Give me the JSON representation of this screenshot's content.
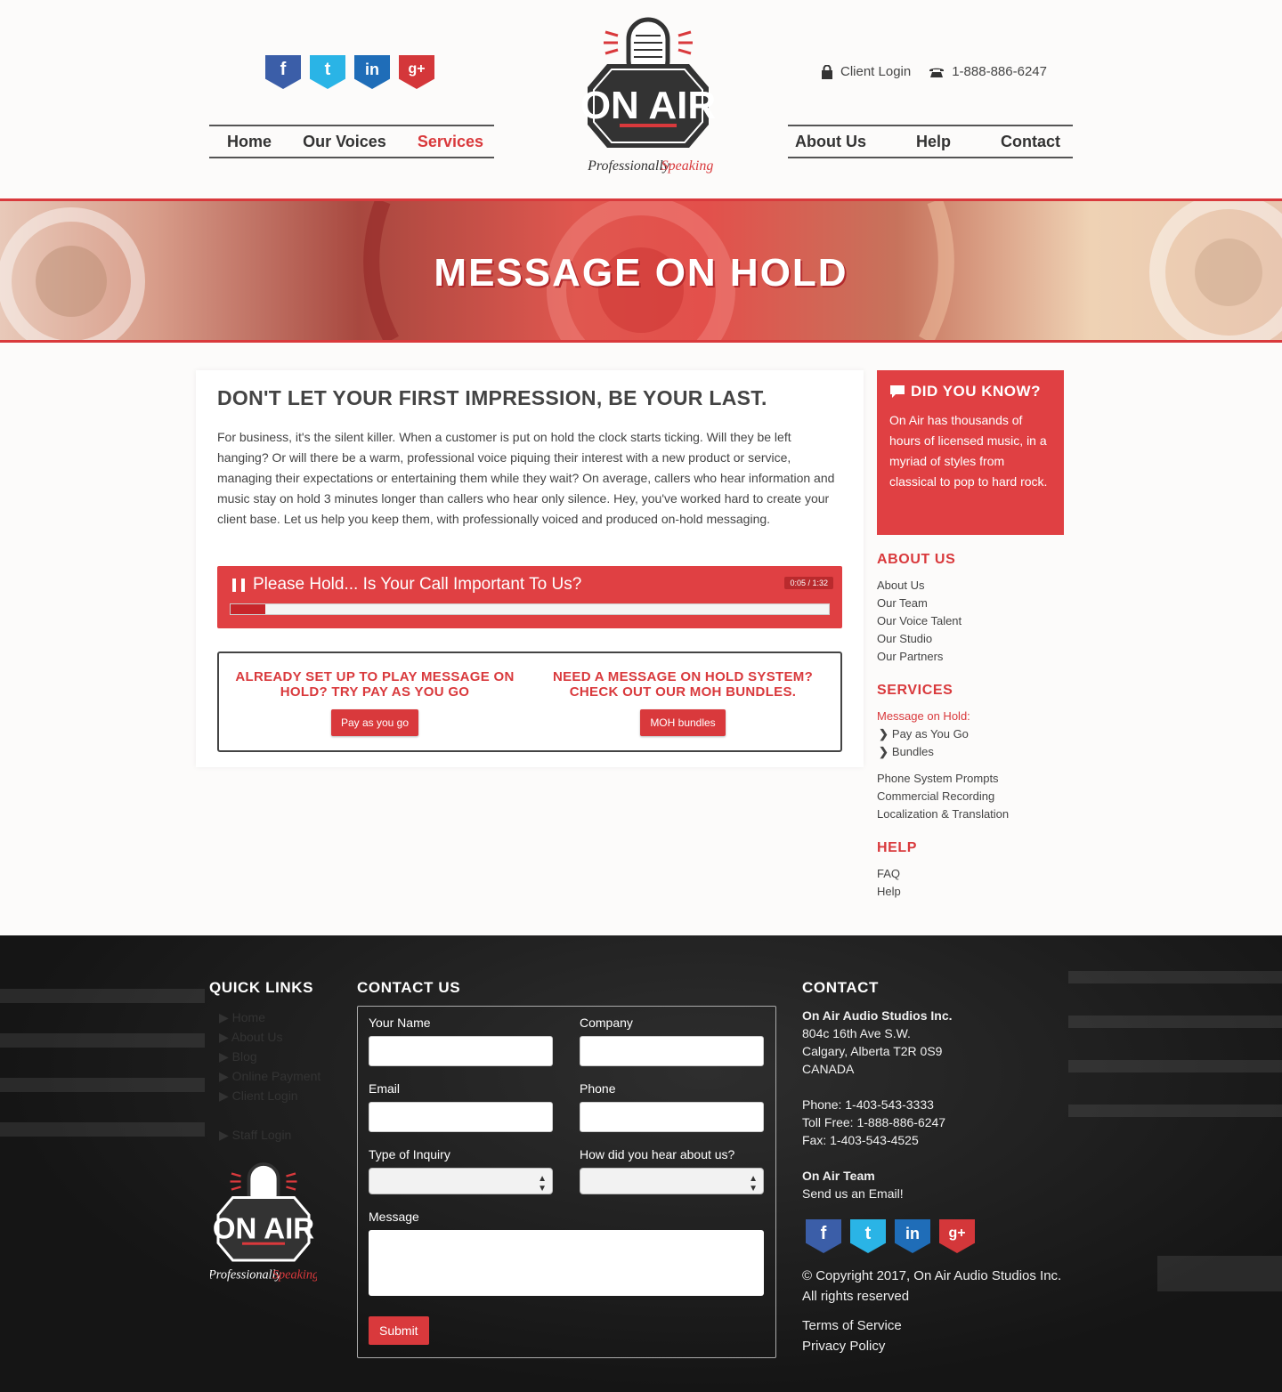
{
  "header": {
    "social": [
      {
        "label": "f",
        "icon": "facebook-icon",
        "color": "#3b5ea8"
      },
      {
        "label": "t",
        "icon": "twitter-icon",
        "color": "#2ab4e6"
      },
      {
        "label": "in",
        "icon": "linkedin-icon",
        "color": "#1f6db8"
      },
      {
        "label": "g+",
        "icon": "googleplus-icon",
        "color": "#d4373a"
      }
    ],
    "nav_left": [
      "Home",
      "Our Voices",
      "Services"
    ],
    "nav_right": [
      "About Us",
      "Help",
      "Contact"
    ],
    "client_login": "Client Login",
    "phone": "1-888-886-6247",
    "logo_text": "ON AIR",
    "logo_tagline_1": "Professionally",
    "logo_tagline_2": "Speaking",
    "accent": "#d9393c"
  },
  "hero": {
    "title": "MESSAGE ON HOLD"
  },
  "main": {
    "headline": "DON'T LET YOUR FIRST IMPRESSION, BE YOUR LAST.",
    "intro": "For business, it's the silent killer. When a customer is put on hold the clock starts ticking. Will they be left hanging? Or will there be a warm, professional voice piquing their interest with a new product or service, managing their expectations or entertaining them while they wait? On average, callers who hear information and music stay on hold 3 minutes longer than callers who hear only silence. Hey, you've worked hard to create your client base. Let us help you keep them, with professionally voiced and produced on-hold messaging.",
    "player": {
      "title": "Please Hold... Is Your Call Important To Us?",
      "time": "0:05 / 1:32",
      "progress_fraction": 0.058
    },
    "cta_left": {
      "title": "ALREADY SET UP TO PLAY MESSAGE ON HOLD? TRY PAY AS YOU GO",
      "button": "Pay as you go"
    },
    "cta_right": {
      "title": "NEED A MESSAGE ON HOLD SYSTEM? CHECK OUT OUR MOH BUNDLES.",
      "button": "MOH bundles"
    }
  },
  "sidebar": {
    "dyk_title": "DID YOU KNOW?",
    "dyk_text": "On Air has thousands of hours of licensed music, in a myriad of styles from classical to pop to hard rock.",
    "about_heading": "ABOUT US",
    "about_items": [
      "About Us",
      "Our Team",
      "Our Voice Talent",
      "Our Studio",
      "Our Partners"
    ],
    "services_heading": "SERVICES",
    "services_active": "Message on Hold:",
    "services_sub": [
      "Pay as You Go",
      "Bundles"
    ],
    "services_items": [
      "Phone System Prompts",
      "Commercial Recording",
      "Localization & Translation"
    ],
    "help_heading": "HELP",
    "help_items": [
      "FAQ",
      "Help"
    ]
  },
  "footer": {
    "quick_heading": "QUICK LINKS",
    "quick_links": [
      "Home",
      "About Us",
      "Blog",
      "Online Payment",
      "Client Login"
    ],
    "staff_login": "Staff Login",
    "contact_us_heading": "CONTACT US",
    "form": {
      "your_name": "Your Name",
      "company": "Company",
      "email": "Email",
      "phone": "Phone",
      "inquiry": "Type of Inquiry",
      "hear": "How did you hear about us?",
      "message": "Message",
      "submit": "Submit"
    },
    "contact_heading": "CONTACT",
    "company_name": "On Air Audio Studios Inc.",
    "address_1": "804c 16th Ave S.W.",
    "address_2": "Calgary, Alberta T2R 0S9",
    "address_3": "CANADA",
    "phone": "Phone: 1-403-543-3333",
    "toll_free": "Toll Free: 1-888-886-6247",
    "fax": "Fax: 1-403-543-4525",
    "team": "On Air Team",
    "email_link": "Send us an Email!",
    "copyright": "© Copyright 2017, On Air Audio Studios Inc.",
    "rights": "All rights reserved",
    "terms": "Terms of Service",
    "privacy": "Privacy Policy"
  }
}
